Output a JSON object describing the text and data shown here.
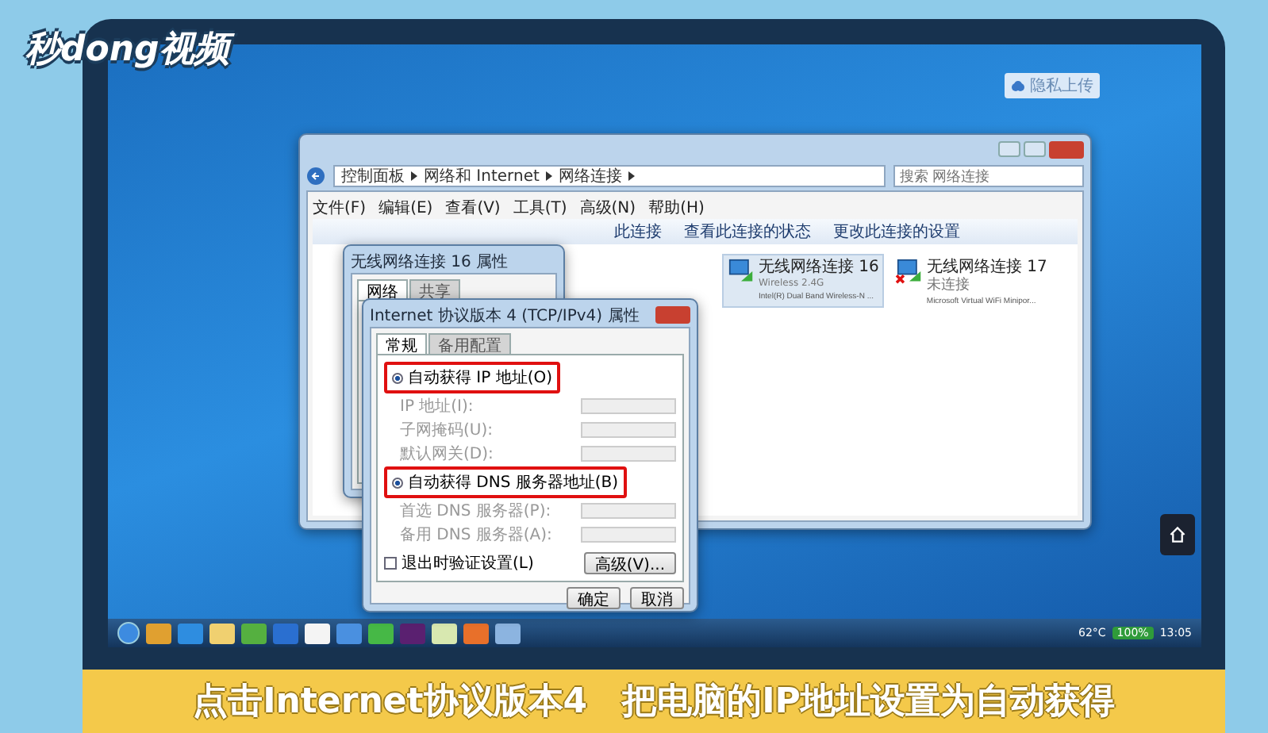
{
  "logo": {
    "text": "秒dong视频"
  },
  "desktop": {
    "badge": "隐私上传"
  },
  "explorer": {
    "breadcrumb": [
      "控制面板",
      "网络和 Internet",
      "网络连接"
    ],
    "search_placeholder": "搜索 网络连接",
    "menu": [
      "文件(F)",
      "编辑(E)",
      "查看(V)",
      "工具(T)",
      "高级(N)",
      "帮助(H)"
    ],
    "toolbar": [
      "此连接",
      "查看此连接的状态",
      "更改此连接的设置"
    ],
    "adapters": [
      {
        "name": "无线网络连接 16",
        "status": "Wireless 2.4G",
        "device": "Intel(R) Dual Band Wireless-N ...",
        "selected": true,
        "disconnected": false
      },
      {
        "name": "无线网络连接 17",
        "status": "未连接",
        "device": "Microsoft Virtual WiFi Minipor...",
        "selected": false,
        "disconnected": true
      }
    ]
  },
  "properties_dialog": {
    "title": "无线网络连接 16 属性",
    "tabs": [
      {
        "label": "网络",
        "selected": true
      },
      {
        "label": "共享",
        "selected": false
      }
    ]
  },
  "tcp_dialog": {
    "title": "Internet 协议版本 4 (TCP/IPv4) 属性",
    "tabs": [
      {
        "label": "常规",
        "selected": true
      },
      {
        "label": "备用配置",
        "selected": false
      }
    ],
    "groups": [
      {
        "option": {
          "label": "自动获得 IP 地址(O)",
          "selected": true,
          "highlighted": true
        },
        "fields": [
          {
            "label": "IP 地址(I):",
            "disabled": true
          },
          {
            "label": "子网掩码(U):",
            "disabled": true
          },
          {
            "label": "默认网关(D):",
            "disabled": true
          }
        ]
      },
      {
        "option": {
          "label": "自动获得 DNS 服务器地址(B)",
          "selected": true,
          "highlighted": true
        },
        "fields": [
          {
            "label": "首选 DNS 服务器(P):",
            "disabled": true
          },
          {
            "label": "备用 DNS 服务器(A):",
            "disabled": true
          }
        ]
      }
    ],
    "checkbox": {
      "label": "退出时验证设置(L)",
      "checked": false
    },
    "advanced": "高级(V)...",
    "buttons": [
      "确定",
      "取消"
    ]
  },
  "taskbar": {
    "temperature": "62°C",
    "battery": "100%",
    "clock": "13:05"
  },
  "caption": "点击Internet协议版本4　把电脑的IP地址设置为自动获得"
}
